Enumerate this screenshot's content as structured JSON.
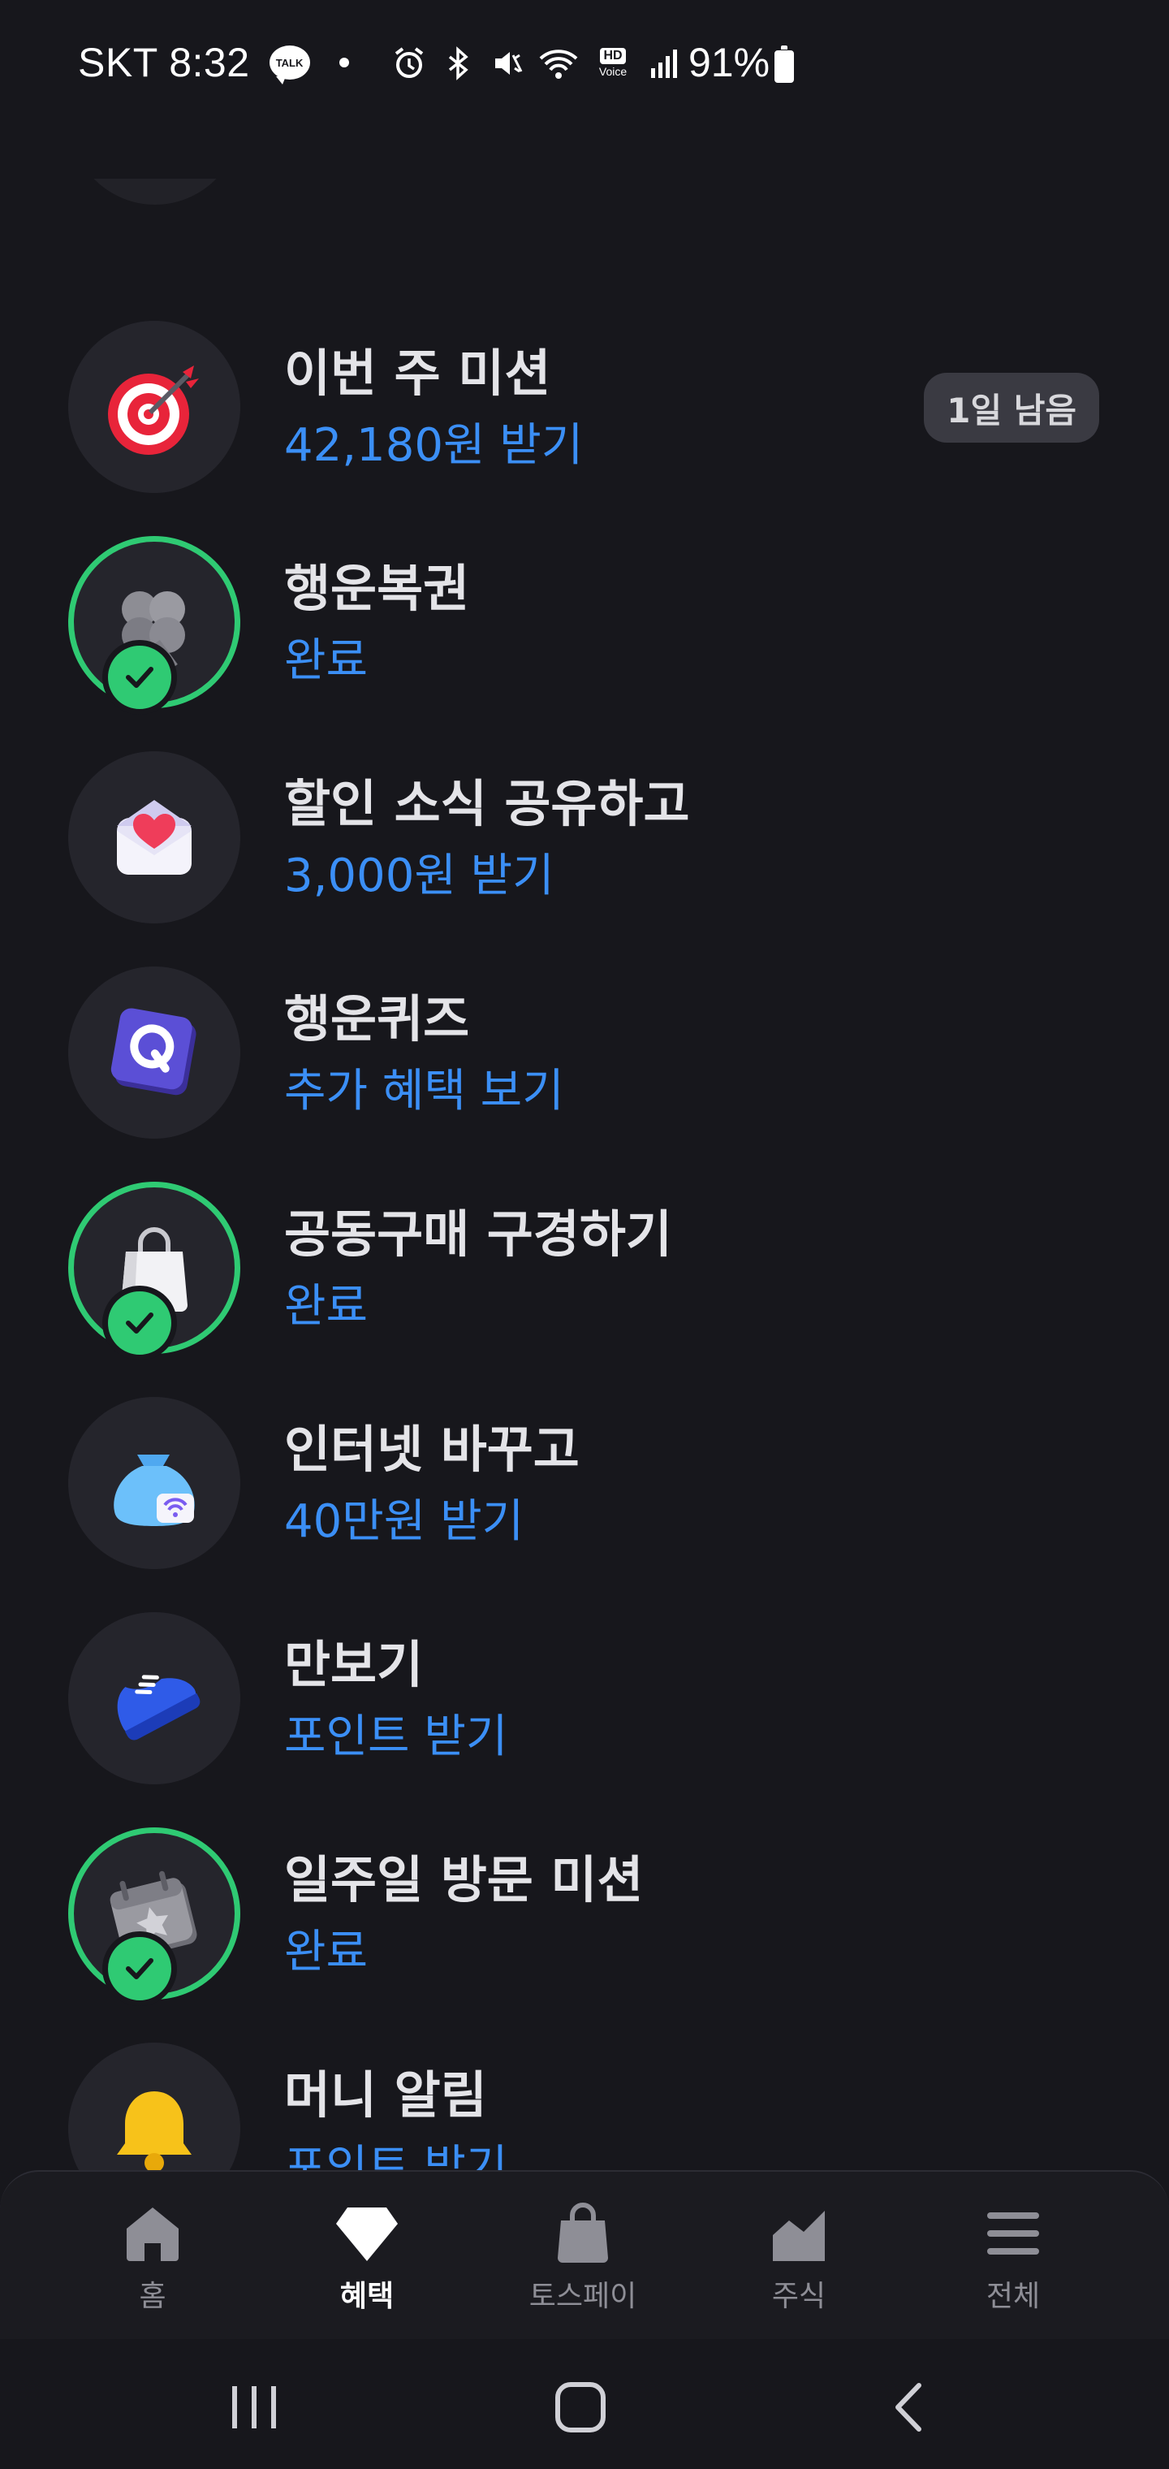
{
  "status_bar": {
    "carrier_time": "SKT 8:32",
    "talk_badge": "TALK",
    "hd_label": "HD",
    "voice_label": "Voice",
    "battery": "91%"
  },
  "missions": [
    {
      "title": "이번 주 미션",
      "subtitle": "42,180원 받기",
      "badge": "1일 남음",
      "icon": "target-dart-icon",
      "done": false
    },
    {
      "title": "행운복권",
      "subtitle": "완료",
      "icon": "clover-icon",
      "done": true
    },
    {
      "title": "할인 소식 공유하고",
      "subtitle": "3,000원 받기",
      "icon": "heart-envelope-icon",
      "done": false
    },
    {
      "title": "행운퀴즈",
      "subtitle": "추가 혜택 보기",
      "icon": "quiz-q-icon",
      "done": false
    },
    {
      "title": "공동구매 구경하기",
      "subtitle": "완료",
      "icon": "shopping-bag-icon",
      "done": true
    },
    {
      "title": "인터넷 바꾸고",
      "subtitle": "40만원 받기",
      "icon": "money-bag-wifi-icon",
      "done": false
    },
    {
      "title": "만보기",
      "subtitle": "포인트 받기",
      "icon": "sneaker-icon",
      "done": false
    },
    {
      "title": "일주일 방문 미션",
      "subtitle": "완료",
      "icon": "calendar-star-icon",
      "done": true
    },
    {
      "title": "머니 알림",
      "subtitle": "포인트 받기",
      "icon": "bell-icon",
      "done": false
    }
  ],
  "bottom_nav": {
    "items": [
      {
        "label": "홈",
        "icon": "home-icon",
        "active": false
      },
      {
        "label": "혜택",
        "icon": "diamond-icon",
        "active": true
      },
      {
        "label": "토스페이",
        "icon": "shopping-bag-nav-icon",
        "active": false
      },
      {
        "label": "주식",
        "icon": "stock-chart-icon",
        "active": false
      },
      {
        "label": "전체",
        "icon": "menu-icon",
        "active": false
      }
    ]
  },
  "colors": {
    "background": "#17171c",
    "accent_blue": "#3b8ff6",
    "done_green": "#2fca73",
    "nav_inactive": "#8e8e96"
  }
}
